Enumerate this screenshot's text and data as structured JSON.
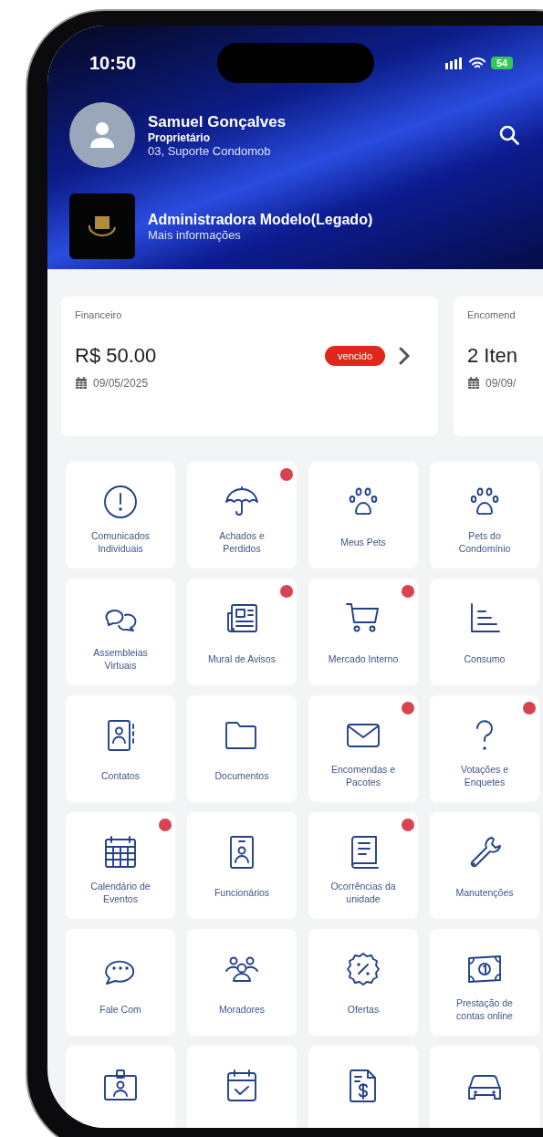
{
  "status_bar": {
    "time": "10:50",
    "battery": "54"
  },
  "profile": {
    "name": "Samuel Gonçalves",
    "role": "Proprietário",
    "unit": "03, Suporte Condomob"
  },
  "administrator": {
    "name": "Administradora Modelo(Legado)",
    "link": "Mais informações"
  },
  "cards": [
    {
      "title": "Financeiro",
      "value": "R$ 50.00",
      "date": "09/05/2025",
      "status": "vencido"
    },
    {
      "title": "Encomend",
      "value": "2 Iten",
      "date": "09/09/"
    }
  ],
  "tiles": [
    {
      "kind": "alert",
      "label": "Comunicados Individuais",
      "notification": false
    },
    {
      "kind": "umbrella",
      "label": "Achados e Perdidos",
      "notification": true
    },
    {
      "kind": "paw",
      "label": "Meus Pets",
      "notification": false
    },
    {
      "kind": "paw",
      "label": "Pets do Condomínio",
      "notification": false
    },
    {
      "kind": "chat",
      "label": "Assembleias Virtuais",
      "notification": false
    },
    {
      "kind": "newspaper",
      "label": "Mural de Avisos",
      "notification": true
    },
    {
      "kind": "cart",
      "label": "Mercado Interno",
      "notification": true
    },
    {
      "kind": "chart",
      "label": "Consumo",
      "notification": false
    },
    {
      "kind": "contacts",
      "label": "Contatos",
      "notification": false
    },
    {
      "kind": "folder",
      "label": "Documentos",
      "notification": false
    },
    {
      "kind": "mail",
      "label": "Encomendas e Pacotes",
      "notification": true
    },
    {
      "kind": "question",
      "label": "Votações e Enquetes",
      "notification": true
    },
    {
      "kind": "calendar",
      "label": "Calendário de Eventos",
      "notification": true
    },
    {
      "kind": "idcard",
      "label": "Funcionários",
      "notification": false
    },
    {
      "kind": "book",
      "label": "Ocorrências da unidade",
      "notification": true
    },
    {
      "kind": "wrench",
      "label": "Manutenções",
      "notification": false
    },
    {
      "kind": "speech",
      "label": "Fale Com",
      "notification": false
    },
    {
      "kind": "people",
      "label": "Moradores",
      "notification": false
    },
    {
      "kind": "discount",
      "label": "Ofertas",
      "notification": false
    },
    {
      "kind": "money",
      "label": "Prestação de contas online",
      "notification": false
    },
    {
      "kind": "badge",
      "notification": false
    },
    {
      "kind": "calcheck",
      "notification": false
    },
    {
      "kind": "invoice",
      "notification": false
    },
    {
      "kind": "car",
      "notification": false
    }
  ]
}
